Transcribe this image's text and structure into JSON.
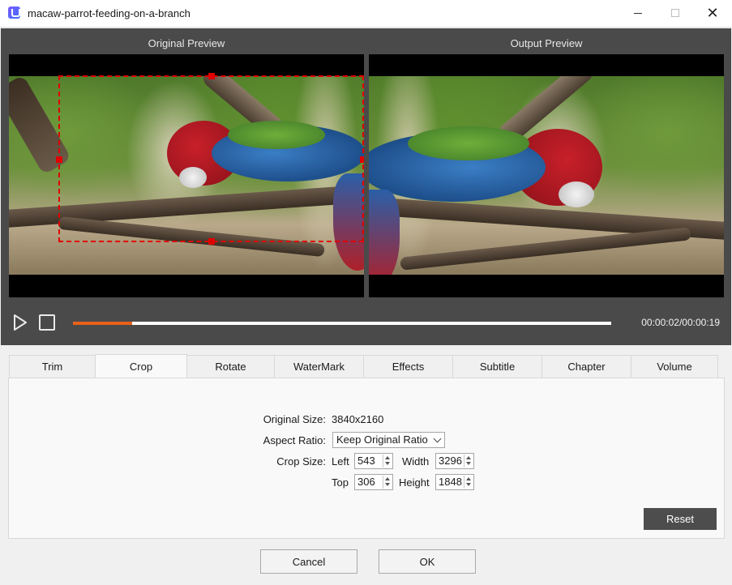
{
  "window": {
    "title": "macaw-parrot-feeding-on-a-branch"
  },
  "preview": {
    "original_label": "Original Preview",
    "output_label": "Output Preview"
  },
  "playback": {
    "time": "00:00:02/00:00:19",
    "progress_fraction": 0.11
  },
  "tabs": [
    {
      "label": "Trim"
    },
    {
      "label": "Crop"
    },
    {
      "label": "Rotate"
    },
    {
      "label": "WaterMark"
    },
    {
      "label": "Effects"
    },
    {
      "label": "Subtitle"
    },
    {
      "label": "Chapter"
    },
    {
      "label": "Volume"
    }
  ],
  "active_tab": "Crop",
  "crop": {
    "original_size_label": "Original Size:",
    "original_size_value": "3840x2160",
    "aspect_ratio_label": "Aspect Ratio:",
    "aspect_ratio_value": "Keep Original Ratio",
    "crop_size_label": "Crop Size:",
    "left_label": "Left",
    "left_value": "543",
    "width_label": "Width",
    "width_value": "3296",
    "top_label": "Top",
    "top_value": "306",
    "height_label": "Height",
    "height_value": "1848",
    "reset_label": "Reset"
  },
  "footer": {
    "cancel_label": "Cancel",
    "ok_label": "OK"
  },
  "colors": {
    "accent": "#e8611a",
    "crop_box": "#e00000"
  }
}
